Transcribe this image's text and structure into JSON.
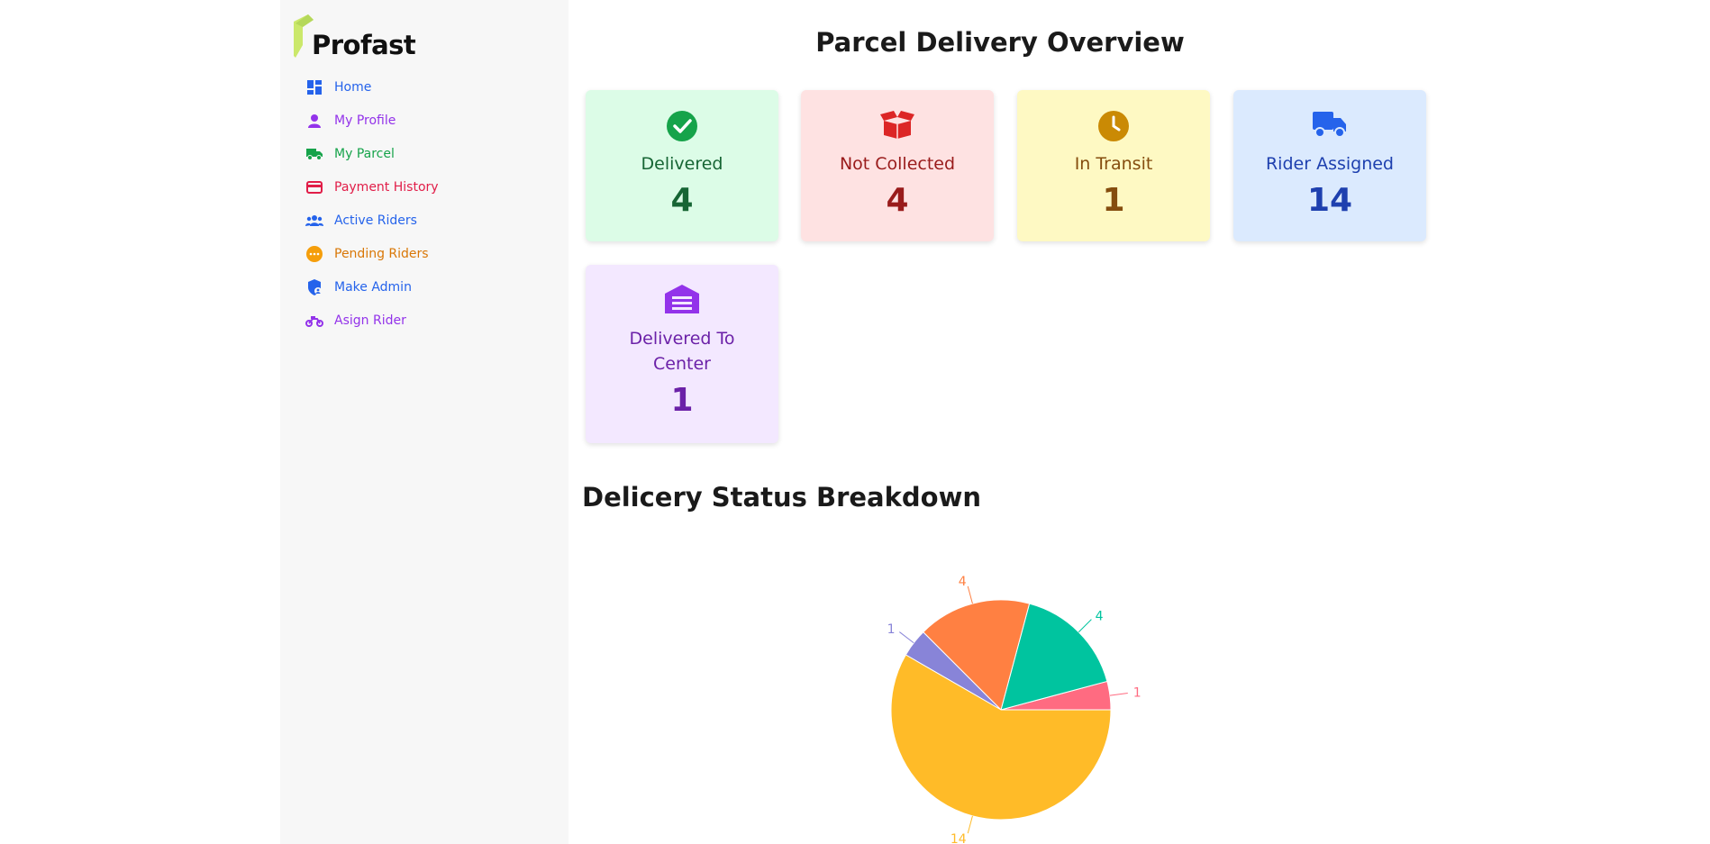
{
  "sidebar": {
    "brand": "Profast",
    "items": [
      {
        "label": "Home",
        "icon": "dashboard-icon",
        "color": "#2563eb"
      },
      {
        "label": "My Profile",
        "icon": "user-icon",
        "color": "#9333ea"
      },
      {
        "label": "My Parcel",
        "icon": "truck-icon",
        "color": "#16a34a"
      },
      {
        "label": "Payment History",
        "icon": "credit-card-icon",
        "color": "#e11d48"
      },
      {
        "label": "Active Riders",
        "icon": "users-icon",
        "color": "#2563eb"
      },
      {
        "label": "Pending Riders",
        "icon": "ellipsis-circle-icon",
        "color": "#d97706"
      },
      {
        "label": "Make Admin",
        "icon": "shield-user-icon",
        "color": "#2563eb"
      },
      {
        "label": "Asign Rider",
        "icon": "motorcycle-icon",
        "color": "#9333ea"
      }
    ]
  },
  "main": {
    "title": "Parcel Delivery Overview",
    "cards": [
      {
        "label": "Delivered",
        "value": "4",
        "icon": "check-circle-icon",
        "bg": "#dcfce7",
        "text": "#166534",
        "accent": "#16a34a"
      },
      {
        "label": "Not Collected",
        "value": "4",
        "icon": "open-box-icon",
        "bg": "#fee2e2",
        "text": "#991b1b",
        "accent": "#dc2626"
      },
      {
        "label": "In Transit",
        "value": "1",
        "icon": "clock-icon",
        "bg": "#fef9c3",
        "text": "#854d0e",
        "accent": "#ca8a04"
      },
      {
        "label": "Rider Assigned",
        "value": "14",
        "icon": "truck-icon",
        "bg": "#dbeafe",
        "text": "#1e40af",
        "accent": "#2563eb"
      },
      {
        "label": "Delivered To Center",
        "value": "1",
        "icon": "warehouse-icon",
        "bg": "#f3e8ff",
        "text": "#6b21a8",
        "accent": "#9333ea"
      }
    ],
    "breakdown_title": "Delicery Status Breakdown"
  },
  "chart_data": {
    "type": "pie",
    "values": [
      1,
      4,
      4,
      1,
      14
    ],
    "labels": [
      "1",
      "4",
      "4",
      "1",
      "14"
    ],
    "colors": [
      "#ff6b81",
      "#00c49f",
      "#ff8042",
      "#8884d8",
      "#ffbb28"
    ]
  }
}
